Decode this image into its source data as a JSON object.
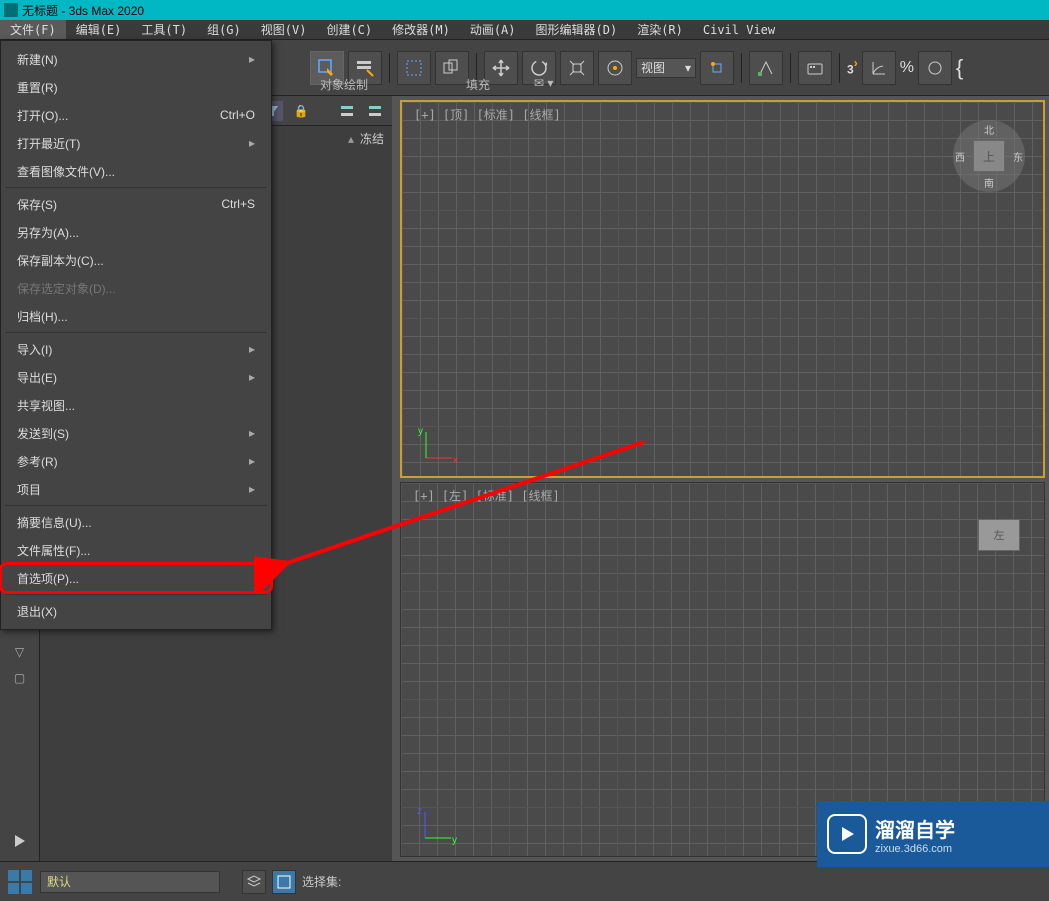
{
  "title": "无标题 - 3ds Max 2020",
  "menubar": [
    "文件(F)",
    "编辑(E)",
    "工具(T)",
    "组(G)",
    "视图(V)",
    "创建(C)",
    "修改器(M)",
    "动画(A)",
    "图形编辑器(D)",
    "渲染(R)",
    "Civil View"
  ],
  "toolbar": {
    "view_dd": "视图",
    "sublabel_1": "对象绘制",
    "sublabel_2": "填充",
    "text_3": "3",
    "text_pct": "%"
  },
  "scene": {
    "freeze": "冻结"
  },
  "dropdown": {
    "items": [
      {
        "label": "新建(N)",
        "arrow": true
      },
      {
        "label": "重置(R)"
      },
      {
        "label": "打开(O)...",
        "shortcut": "Ctrl+O"
      },
      {
        "label": "打开最近(T)",
        "arrow": true
      },
      {
        "label": "查看图像文件(V)..."
      },
      {
        "sep": true
      },
      {
        "label": "保存(S)",
        "shortcut": "Ctrl+S"
      },
      {
        "label": "另存为(A)..."
      },
      {
        "label": "保存副本为(C)..."
      },
      {
        "label": "保存选定对象(D)...",
        "disabled": true
      },
      {
        "label": "归档(H)..."
      },
      {
        "sep": true
      },
      {
        "label": "导入(I)",
        "arrow": true
      },
      {
        "label": "导出(E)",
        "arrow": true
      },
      {
        "label": "共享视图..."
      },
      {
        "label": "发送到(S)",
        "arrow": true
      },
      {
        "label": "参考(R)",
        "arrow": true
      },
      {
        "label": "项目",
        "arrow": true
      },
      {
        "sep": true
      },
      {
        "label": "摘要信息(U)..."
      },
      {
        "label": "文件属性(F)..."
      },
      {
        "label": "首选项(P)...",
        "highlight": true
      },
      {
        "sep": true
      },
      {
        "label": "退出(X)"
      }
    ]
  },
  "viewports": {
    "top_label": "[+] [顶] [标准] [线框]",
    "left_label": "[+] [左] [标准] [线框]",
    "vc_top_n": "北",
    "vc_top_s": "南",
    "vc_top_e": "东",
    "vc_top_w": "西",
    "vc_top_face": "上",
    "vc_left": "左",
    "axis_x": "x",
    "axis_y": "y",
    "axis_z": "z"
  },
  "bottom": {
    "layer": "默认",
    "selset": "选择集:"
  },
  "watermark": {
    "line1": "溜溜自学",
    "line2": "zixue.3d66.com"
  }
}
